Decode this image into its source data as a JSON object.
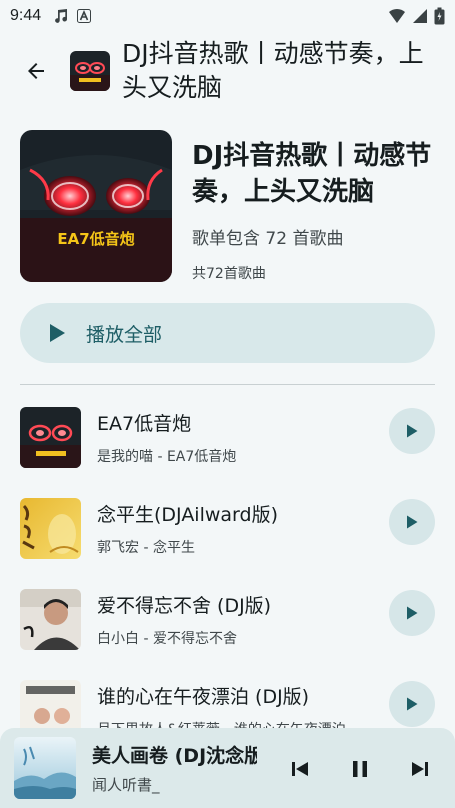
{
  "status_bar": {
    "time": "9:44",
    "left_icons": [
      "music-note-icon",
      "text-a-icon"
    ],
    "right_icons": [
      "wifi-icon",
      "cell-signal-icon",
      "battery-icon"
    ]
  },
  "top_bar": {
    "back_icon": "arrow-back-icon",
    "title": "DJ抖音热歌丨动感节奏，上头又洗脑"
  },
  "playlist": {
    "title": "DJ抖音热歌丨动感节奏，上头又洗脑",
    "subtitle": "歌单包含 72 首歌曲",
    "count_text": "共72首歌曲",
    "cover_text": "EA7低音炮"
  },
  "play_all": {
    "label": "播放全部",
    "icon": "play-icon"
  },
  "songs": [
    {
      "title": "EA7低音炮",
      "artist": "是我的喵 - EA7低音炮",
      "thumb": "car-taillight"
    },
    {
      "title": "念平生(DJAilward版)",
      "artist": "郭飞宏 - 念平生",
      "thumb": "yellow-calligraphy"
    },
    {
      "title": "爱不得忘不舍 (DJ版)",
      "artist": "白小白 - 爱不得忘不舍",
      "thumb": "portrait-man"
    },
    {
      "title": "谁的心在午夜漂泊 (DJ版)",
      "artist": "月下思故人&红蔷薇 - 谁的心在午夜漂泊",
      "thumb": "duo-portrait"
    }
  ],
  "mini_player": {
    "title": "美人画卷 (DJ沈念版)",
    "artist": "闻人听書_",
    "controls": [
      "skip-previous-icon",
      "pause-icon",
      "skip-next-icon"
    ]
  },
  "colors": {
    "background": "#f3f7f8",
    "accent": "#1e5e66",
    "tonal_button": "#d8e8ea",
    "mini_player_bg": "#dce9ea"
  }
}
